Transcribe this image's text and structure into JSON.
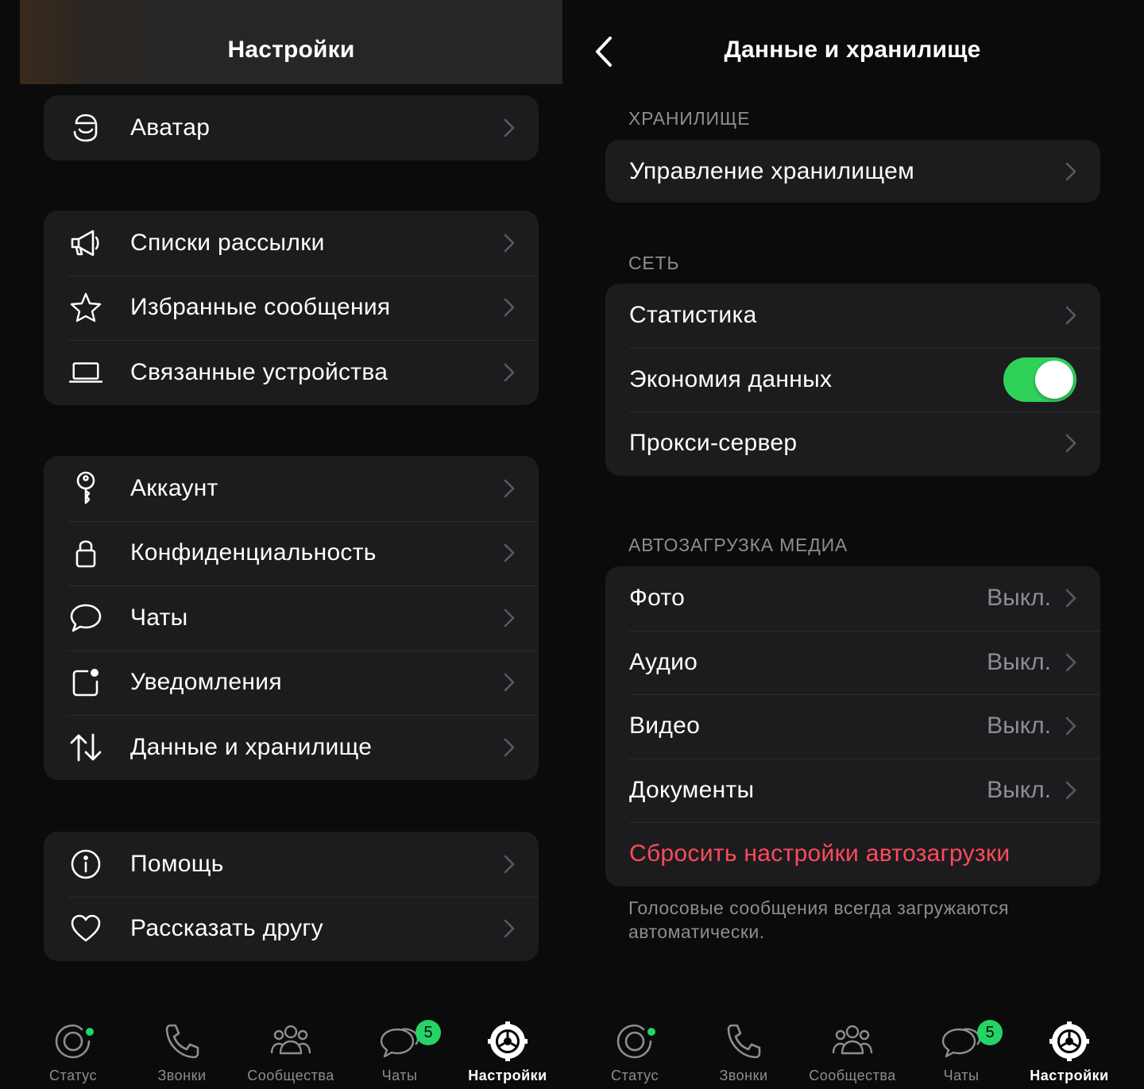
{
  "left": {
    "title": "Настройки",
    "groups": [
      {
        "items": [
          {
            "icon": "avatar-icon",
            "label": "Аватар"
          }
        ]
      },
      {
        "items": [
          {
            "icon": "megaphone-icon",
            "label": "Списки рассылки"
          },
          {
            "icon": "star-icon",
            "label": "Избранные сообщения"
          },
          {
            "icon": "laptop-icon",
            "label": "Связанные устройства"
          }
        ]
      },
      {
        "items": [
          {
            "icon": "key-icon",
            "label": "Аккаунт"
          },
          {
            "icon": "lock-icon",
            "label": "Конфиденциальность"
          },
          {
            "icon": "chat-bubble-icon",
            "label": "Чаты"
          },
          {
            "icon": "notification-icon",
            "label": "Уведомления"
          },
          {
            "icon": "data-arrows-icon",
            "label": "Данные и хранилище"
          }
        ]
      },
      {
        "items": [
          {
            "icon": "info-icon",
            "label": "Помощь"
          },
          {
            "icon": "heart-icon",
            "label": "Рассказать другу"
          }
        ]
      }
    ]
  },
  "right": {
    "title": "Данные и хранилище",
    "sections": {
      "storage": "ХРАНИЛИЩЕ",
      "network": "СЕТЬ",
      "autodownload": "АВТОЗАГРУЗКА МЕДИА"
    },
    "storage_items": [
      {
        "label": "Управление хранилищем"
      }
    ],
    "network_items": [
      {
        "label": "Статистика"
      },
      {
        "label": "Экономия данных",
        "toggle": true
      },
      {
        "label": "Прокси-сервер"
      }
    ],
    "media_items": [
      {
        "label": "Фото",
        "value": "Выкл."
      },
      {
        "label": "Аудио",
        "value": "Выкл."
      },
      {
        "label": "Видео",
        "value": "Выкл."
      },
      {
        "label": "Документы",
        "value": "Выкл."
      }
    ],
    "reset_label": "Сбросить настройки автозагрузки",
    "footnote": "Голосовые сообщения всегда загружаются автоматически."
  },
  "tabbar": {
    "tabs": [
      {
        "label": "Статус",
        "icon": "status-icon"
      },
      {
        "label": "Звонки",
        "icon": "phone-icon"
      },
      {
        "label": "Сообщества",
        "icon": "communities-icon"
      },
      {
        "label": "Чаты",
        "icon": "chats-icon",
        "badge": "5"
      },
      {
        "label": "Настройки",
        "icon": "settings-icon",
        "active": true
      }
    ]
  },
  "colors": {
    "accent": "#25d366",
    "toggle_on": "#30d158",
    "danger": "#ff4a5c",
    "secondary_text": "#8d8d93",
    "card": "#1c1c1e"
  }
}
